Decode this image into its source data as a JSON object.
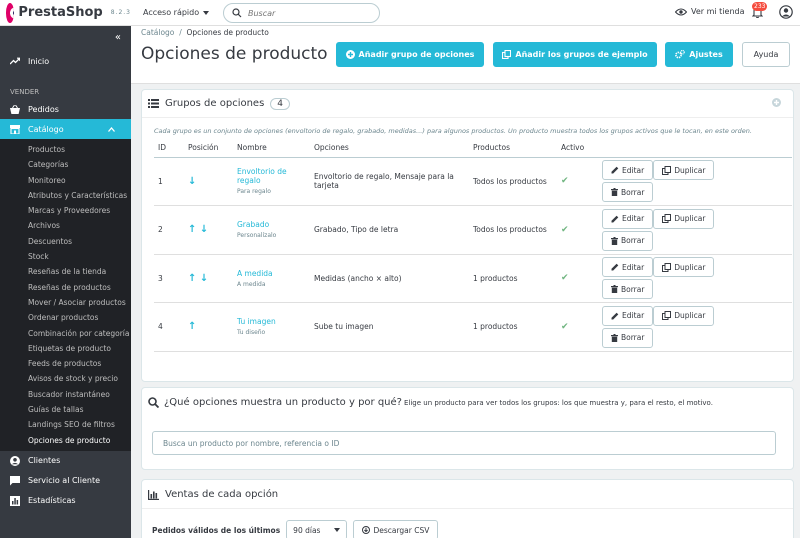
{
  "brand": {
    "name": "PrestaShop",
    "version": "8.2.3"
  },
  "topbar": {
    "quick_access": "Acceso rápido",
    "search_placeholder": "Buscar",
    "view_store": "Ver mi tienda",
    "notifications_count": "233"
  },
  "sidebar": {
    "home": "Inicio",
    "section_sell": "VENDER",
    "orders": "Pedidos",
    "catalog": "Catálogo",
    "catalog_items": [
      "Productos",
      "Categorías",
      "Monitoreo",
      "Atributos y Características",
      "Marcas y Proveedores",
      "Archivos",
      "Descuentos",
      "Stock",
      "Reseñas de la tienda",
      "Reseñas de productos",
      "Mover / Asociar productos",
      "Ordenar productos",
      "Combinación por categoría",
      "Etiquetas de producto",
      "Feeds de productos",
      "Avisos de stock y precio",
      "Buscador instantáneo",
      "Guías de tallas",
      "Landings SEO de filtros",
      "Opciones de producto"
    ],
    "customers": "Clientes",
    "service": "Servicio al Cliente",
    "stats": "Estadísticas"
  },
  "header": {
    "breadcrumb_parent": "Catálogo",
    "breadcrumb_sep": "/",
    "breadcrumb_current": "Opciones de producto",
    "title": "Opciones de producto",
    "btn_add_group": "Añadir grupo de opciones",
    "btn_add_examples": "Añadir los grupos de ejemplo",
    "btn_settings": "Ajustes",
    "btn_help": "Ayuda"
  },
  "groups_panel": {
    "title": "Grupos de opciones",
    "count": "4",
    "description": "Cada grupo es un conjunto de opciones (envoltorio de regalo, grabado, medidas...) para algunos productos. Un producto muestra todos los grupos activos que le tocan, en este orden.",
    "columns": {
      "id": "ID",
      "position": "Posición",
      "name": "Nombre",
      "options": "Opciones",
      "products": "Productos",
      "active": "Activo"
    },
    "actions": {
      "edit": "Editar",
      "duplicate": "Duplicar",
      "delete": "Borrar"
    },
    "rows": [
      {
        "id": "1",
        "arrows": "↓",
        "name": "Envoltorio de regalo",
        "sub": "Para regalo",
        "options": "Envoltorio de regalo, Mensaje para la tarjeta",
        "products": "Todos los productos",
        "active": "✔"
      },
      {
        "id": "2",
        "arrows": "↑ ↓",
        "name": "Grabado",
        "sub": "Personalízalo",
        "options": "Grabado, Tipo de letra",
        "products": "Todos los productos",
        "active": "✔"
      },
      {
        "id": "3",
        "arrows": "↑ ↓",
        "name": "A medida",
        "sub": "A medida",
        "options": "Medidas (ancho × alto)",
        "products": "1 productos",
        "active": "✔"
      },
      {
        "id": "4",
        "arrows": "↑",
        "name": "Tu imagen",
        "sub": "Tu diseño",
        "options": "Sube tu imagen",
        "products": "1 productos",
        "active": "✔"
      }
    ]
  },
  "question_panel": {
    "title": "¿Qué opciones muestra un producto y por qué?",
    "description": "Elige un producto para ver todos los grupos: los que muestra y, para el resto, el motivo.",
    "input_placeholder": "Busca un producto por nombre, referencia o ID"
  },
  "sales_panel": {
    "title": "Ventas de cada opción",
    "filter_label": "Pedidos válidos de los últimos",
    "period_value": "90 días",
    "download": "Descargar CSV"
  }
}
